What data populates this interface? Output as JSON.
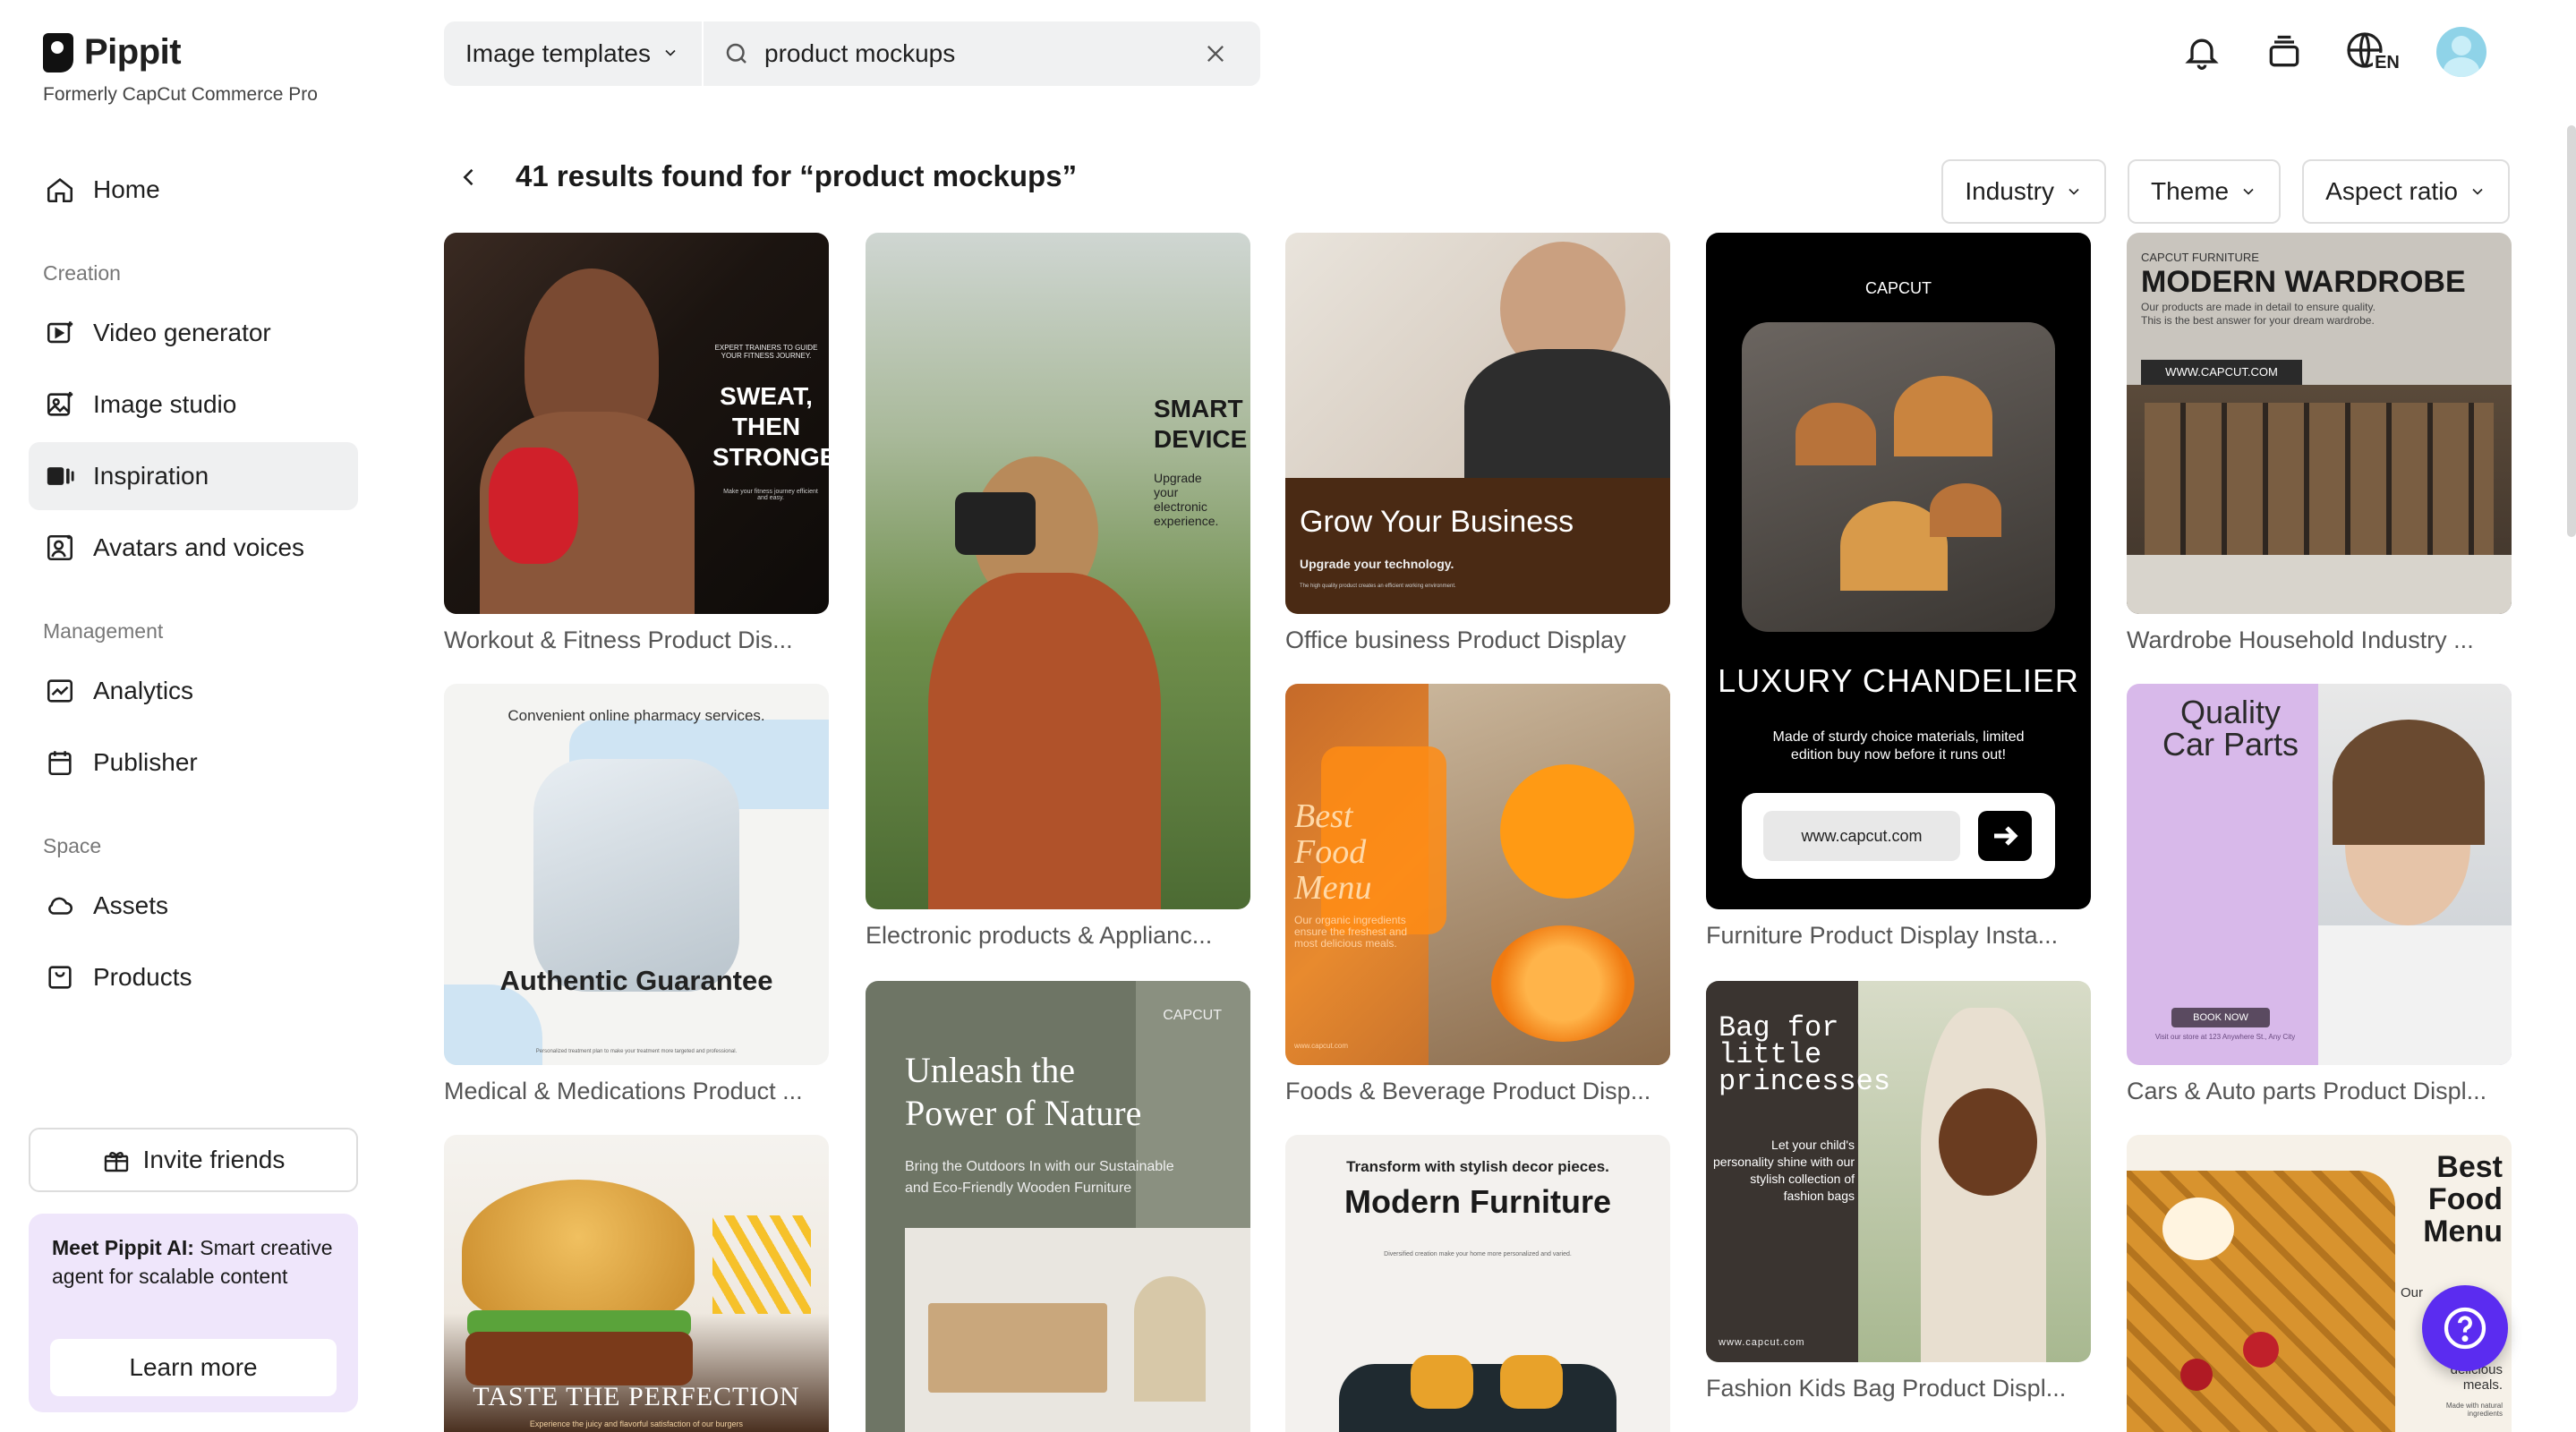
{
  "app": {
    "name": "Pippit",
    "subtitle": "Formerly CapCut Commerce Pro"
  },
  "sidebar": {
    "home": "Home",
    "sections": {
      "creation": "Creation",
      "management": "Management",
      "space": "Space"
    },
    "creation_items": [
      "Video generator",
      "Image studio",
      "Inspiration",
      "Avatars and voices"
    ],
    "management_items": [
      "Analytics",
      "Publisher"
    ],
    "space_items": [
      "Assets",
      "Products"
    ],
    "active_item": "Inspiration",
    "invite_label": "Invite friends",
    "promo": {
      "bold": "Meet Pippit AI:",
      "text": " Smart creative agent for scalable content",
      "button": "Learn more"
    }
  },
  "search": {
    "type_label": "Image templates",
    "query": "product mockups"
  },
  "topbar": {
    "language": "EN"
  },
  "results": {
    "title": "41 results found for “product mockups”",
    "filters": [
      "Industry",
      "Theme",
      "Aspect ratio"
    ]
  },
  "cards": [
    {
      "caption": "Workout & Fitness Product Dis...",
      "lines": [
        "EXPERT TRAINERS TO GUIDE YOUR FITNESS JOURNEY.",
        "SWEAT,",
        "THEN",
        "STRONGER",
        "Make your fitness journey efficient and easy."
      ]
    },
    {
      "caption": "Medical & Medications Product ...",
      "lines": [
        "Convenient online pharmacy services.",
        "Authentic Guarantee",
        "Personalized treatment plan to make your treatment more targeted and professional."
      ]
    },
    {
      "caption": "",
      "lines": [
        "TASTE THE PERFECTION",
        "Experience the juicy and flavorful satisfaction of our burgers"
      ]
    },
    {
      "caption": "Electronic products & Applianc...",
      "lines": [
        "SMART",
        "DEVICE",
        "Upgrade",
        "your",
        "electronic",
        "experience."
      ]
    },
    {
      "caption": "",
      "lines": [
        "CAPCUT",
        "Unleash the",
        "Power of Nature",
        "Bring the Outdoors In with our Sustainable",
        "and Eco-Friendly Wooden Furniture"
      ]
    },
    {
      "caption": "Office business Product Display",
      "lines": [
        "Grow Your Business",
        "Upgrade your technology.",
        "The high quality product creates an efficient working environment."
      ]
    },
    {
      "caption": "Foods & Beverage Product Disp...",
      "lines": [
        "Best",
        "Food",
        "Menu",
        "Our organic ingredients ensure the freshest and most delicious meals.",
        "www.capcut.com"
      ]
    },
    {
      "caption": "",
      "lines": [
        "Transform with stylish decor pieces.",
        "Modern Furniture",
        "Diversified creation make your home more personalized and varied."
      ]
    },
    {
      "caption": "Furniture Product Display Insta...",
      "lines": [
        "CAPCUT",
        "LUXURY CHANDELIER",
        "Made of sturdy choice materials, limited edition buy now before it runs out!",
        "www.capcut.com"
      ]
    },
    {
      "caption": "Fashion Kids Bag Product Displ...",
      "lines": [
        "Bag for",
        "little",
        "princesses",
        "Let your child's personality shine with our stylish collection of fashion bags",
        "www.capcut.com"
      ]
    },
    {
      "caption": "Wardrobe Household Industry ...",
      "lines": [
        "CAPCUT FURNITURE",
        "MODERN WARDROBE",
        "Our products are made in detail to ensure quality.",
        "This is the best answer for your dream wardrobe.",
        "WWW.CAPCUT.COM"
      ]
    },
    {
      "caption": "Cars & Auto parts Product Displ...",
      "lines": [
        "Quality",
        "Car Parts",
        "BOOK NOW",
        "Visit our store at 123 Anywhere St., Any City"
      ]
    },
    {
      "caption": "",
      "lines": [
        "Best",
        "Food",
        "Menu",
        "Our",
        "delicious",
        "meals.",
        "Made with natural ingredients"
      ]
    }
  ],
  "colors": {
    "accent": "#5b2cf0",
    "active_bg": "#eff0f1",
    "promo_bg": "#efe6fb"
  }
}
